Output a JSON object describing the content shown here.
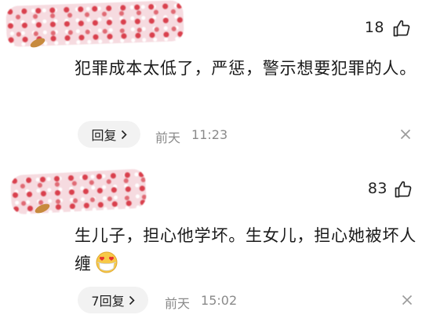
{
  "comments": [
    {
      "likes": "18",
      "text": "犯罪成本太低了，严惩，警示想要犯罪的人。",
      "reply_label": "回复",
      "date": "前天",
      "time": "11:23"
    },
    {
      "likes": "83",
      "text": "生儿子，担心他学坏。生女儿，担心她被坏人缠",
      "emoji": "smiling-face-with-heart-eyes-mask",
      "reply_label": "7回复",
      "date": "前天",
      "time": "15:02"
    }
  ],
  "icons": {
    "like": "thumbs-up-icon",
    "reply_arrow": "chevron-right-icon",
    "dismiss": "close-icon",
    "emoji": "heart-eyes-mask-emoji"
  },
  "colors": {
    "reply_bg": "#f2f2f2",
    "meta_text": "#8a8a8a",
    "avatar_blur": "#f6dbe0"
  }
}
